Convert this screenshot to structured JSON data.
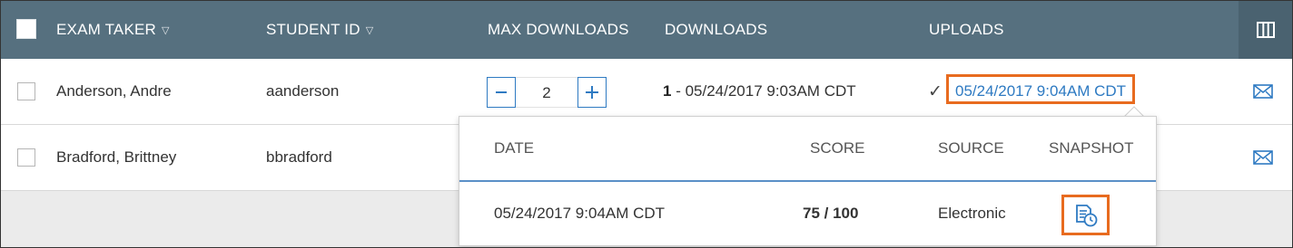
{
  "columns": {
    "exam_taker": "EXAM TAKER",
    "student_id": "STUDENT ID",
    "max_downloads": "MAX DOWNLOADS",
    "downloads": "DOWNLOADS",
    "uploads": "UPLOADS",
    "sort_icon": "caret-down-icon"
  },
  "rows": [
    {
      "name": "Anderson, Andre",
      "student_id": "aanderson",
      "max_downloads": "2",
      "downloads_count": "1",
      "downloads_text": " - 05/24/2017 9:03AM CDT",
      "upload": "05/24/2017 9:04AM CDT",
      "upload_check": "✓"
    },
    {
      "name": "Bradford, Brittney",
      "student_id": "bbradford"
    }
  ],
  "popover": {
    "headers": {
      "date": "DATE",
      "score": "SCORE",
      "source": "SOURCE",
      "snapshot": "SNAPSHOT"
    },
    "row": {
      "date": "05/24/2017 9:04AM CDT",
      "score": "75 / 100",
      "source": "Electronic"
    }
  },
  "colors": {
    "header_bg": "#56707f",
    "link": "#2e7ac2",
    "highlight": "#e86b1f"
  },
  "icons": [
    "checkbox-icon",
    "columns-icon",
    "minus-icon",
    "plus-icon",
    "mail-icon",
    "snapshot-icon"
  ]
}
